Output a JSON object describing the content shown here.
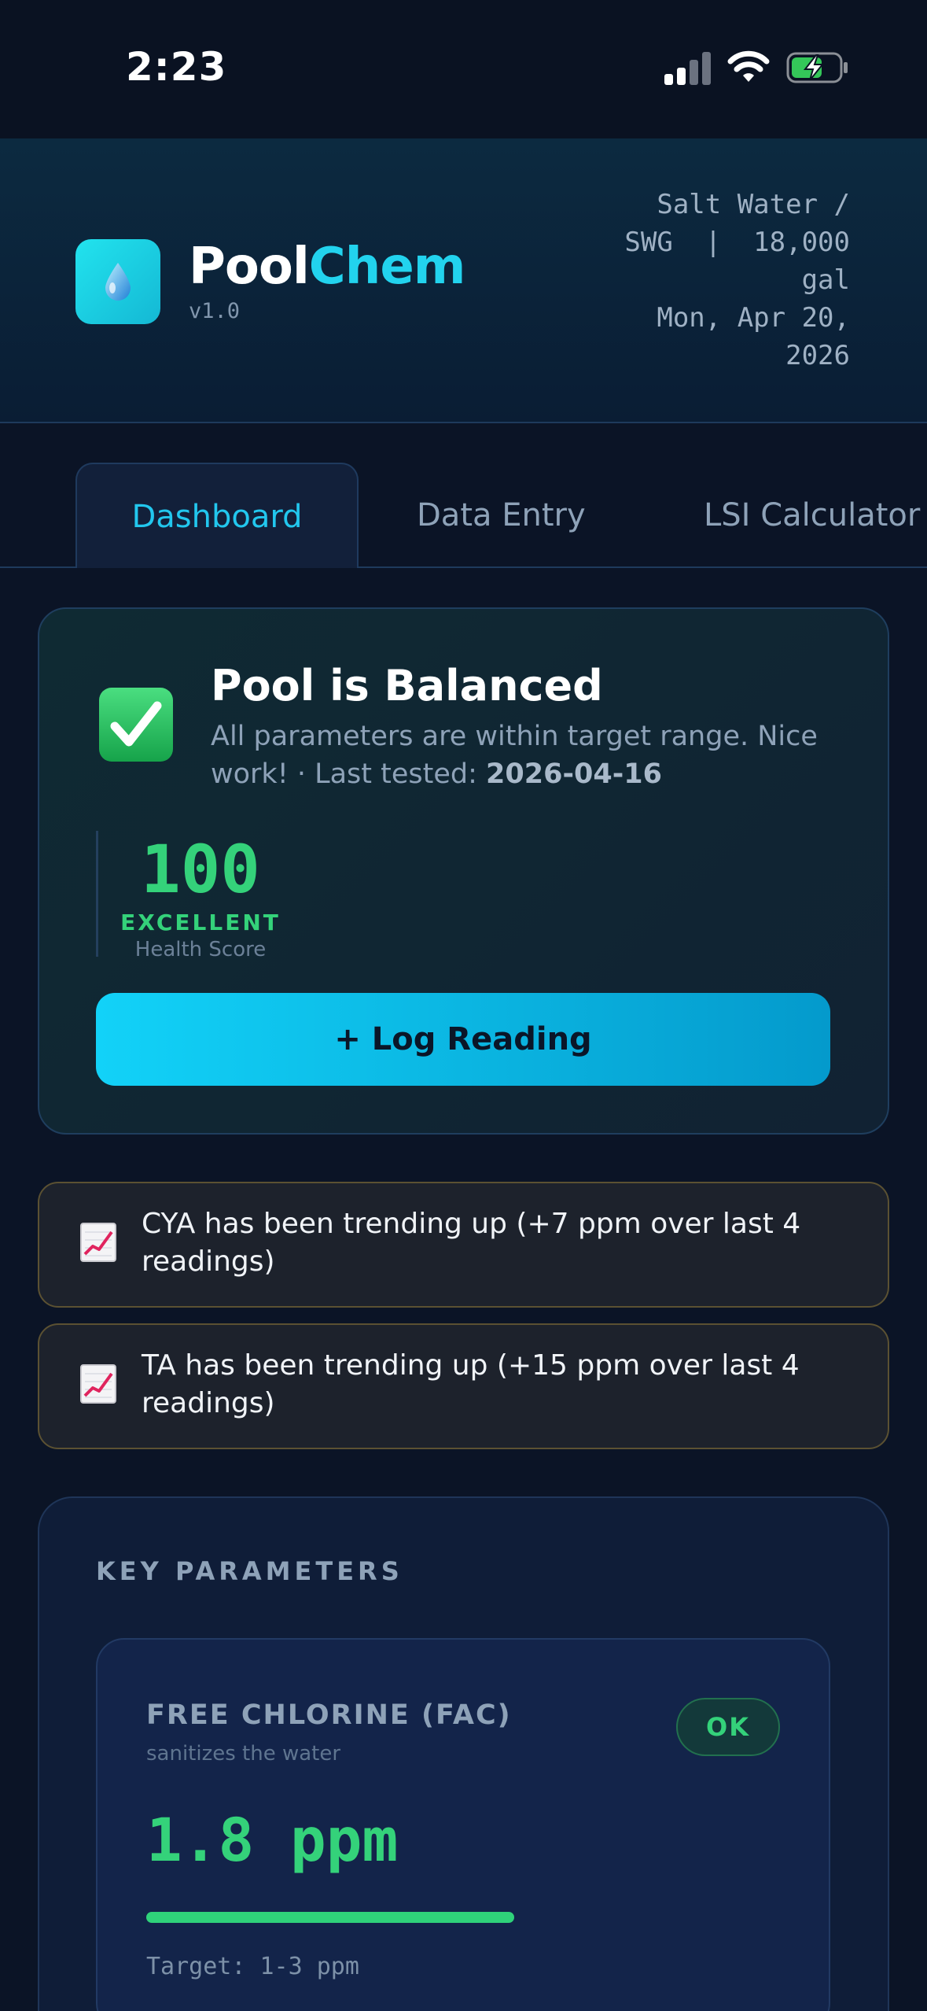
{
  "status_bar": {
    "time": "2:23",
    "signal_icon": "cellular-signal-icon",
    "wifi_icon": "wifi-icon",
    "battery_icon": "battery-charging-icon"
  },
  "header": {
    "logo_icon": "water-drop-icon",
    "brand_part1": "Pool",
    "brand_part2": "Chem",
    "version": "v1.0",
    "pool_type": "Salt Water /",
    "pool_info": "SWG  |  18,000 gal",
    "date": "Mon, Apr 20, 2026"
  },
  "tabs": [
    {
      "label": "Dashboard",
      "active": true
    },
    {
      "label": "Data Entry",
      "active": false
    },
    {
      "label": "LSI Calculator",
      "active": false
    }
  ],
  "status_card": {
    "icon": "check-mark-icon",
    "title": "Pool is Balanced",
    "subtitle": "All parameters are within target range. Nice work!  ·  Last tested:",
    "last_tested": "2026-04-16",
    "score": "100",
    "rating": "EXCELLENT",
    "score_caption": "Health Score",
    "log_button": "+ Log Reading"
  },
  "alerts": [
    {
      "icon": "chart-increasing-icon",
      "text": "CYA has been trending up (+7 ppm over last 4 readings)"
    },
    {
      "icon": "chart-increasing-icon",
      "text": "TA has been trending up (+15 ppm over last 4 readings)"
    }
  ],
  "key_parameters": {
    "heading": "KEY PARAMETERS",
    "params": [
      {
        "name": "FREE CHLORINE (FAC)",
        "description": "sanitizes the water",
        "status": "OK",
        "value": "1.8 ppm",
        "level_fraction": 0.6,
        "target": "Target: 1-3 ppm"
      }
    ]
  },
  "colors": {
    "background": "#0b1426",
    "accent": "#22d3ee",
    "ok": "#34d27a",
    "warning_border": "#5b5132"
  }
}
